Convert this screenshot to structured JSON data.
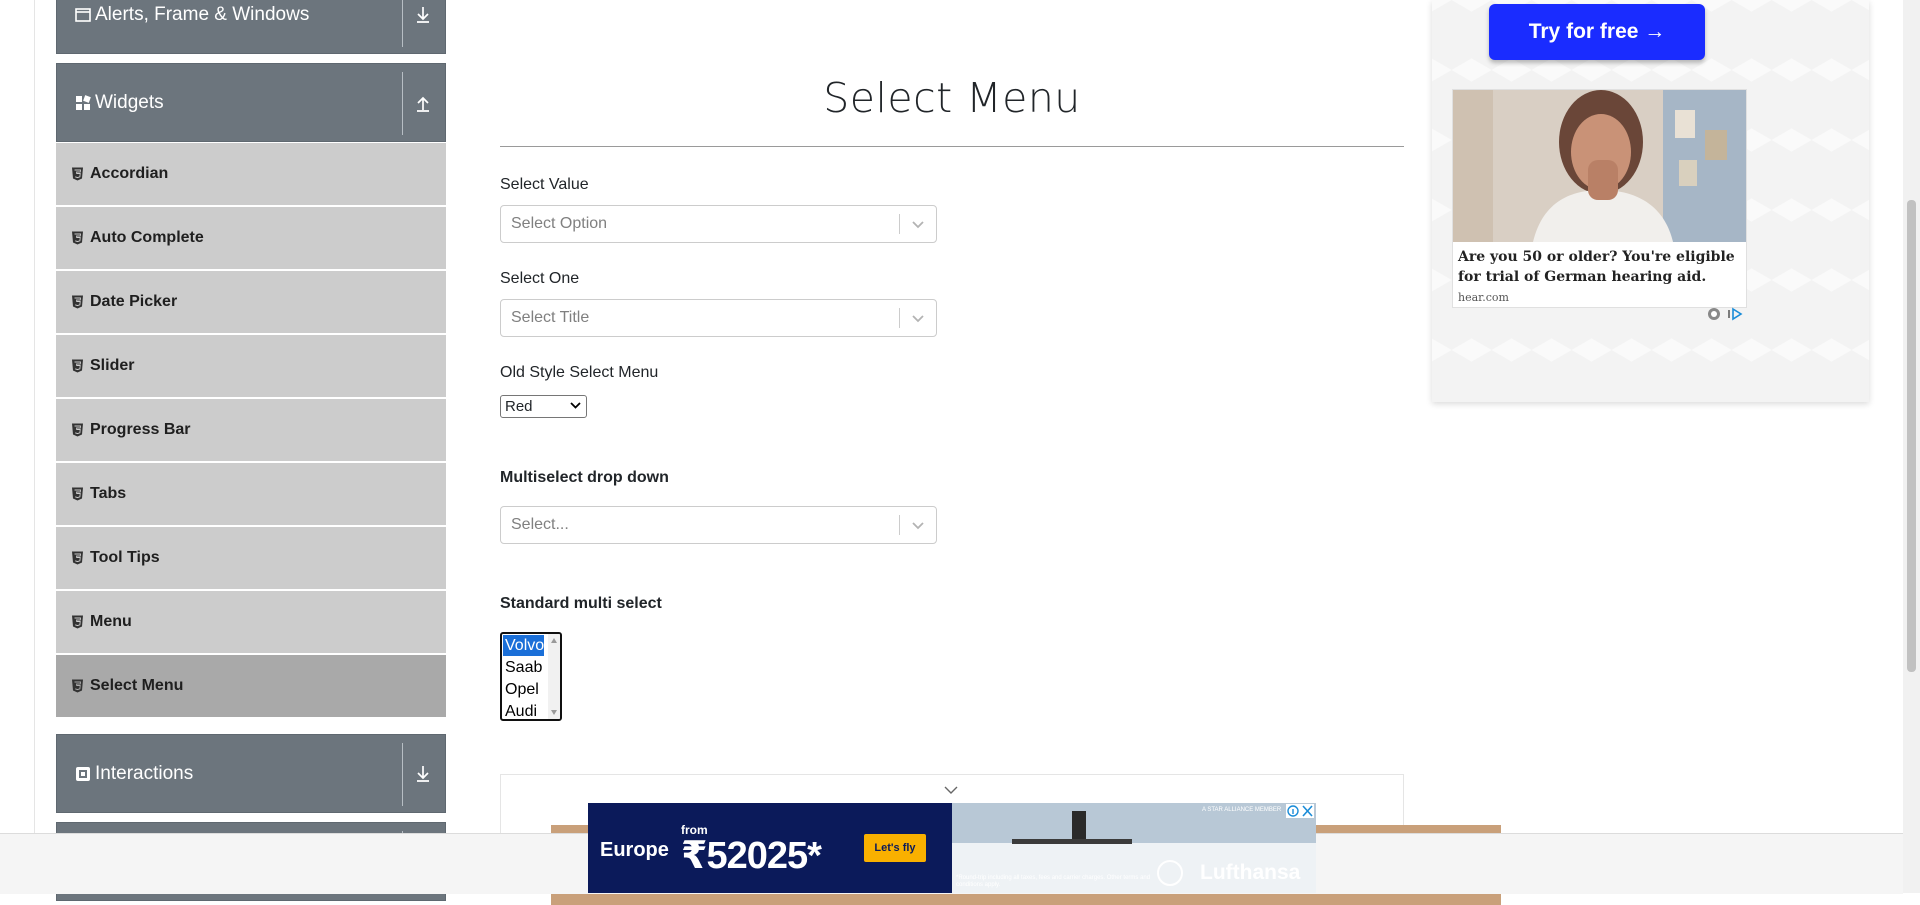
{
  "sidebar": {
    "groups": [
      {
        "label": "Alerts, Frame & Windows",
        "toggle_icon": "arrow-down-icon"
      },
      {
        "label": "Widgets",
        "toggle_icon": "arrow-up-icon"
      },
      {
        "label": "Interactions",
        "toggle_icon": "arrow-down-icon"
      }
    ],
    "items": [
      {
        "label": "Accordian"
      },
      {
        "label": "Auto Complete"
      },
      {
        "label": "Date Picker"
      },
      {
        "label": "Slider"
      },
      {
        "label": "Progress Bar"
      },
      {
        "label": "Tabs"
      },
      {
        "label": "Tool Tips"
      },
      {
        "label": "Menu"
      },
      {
        "label": "Select Menu",
        "active": true
      }
    ]
  },
  "main": {
    "title": "Select Menu",
    "select_value": {
      "label": "Select Value",
      "placeholder": "Select Option"
    },
    "select_one": {
      "label": "Select One",
      "placeholder": "Select Title"
    },
    "old_style": {
      "label": "Old Style Select Menu",
      "value": "Red"
    },
    "multiselect": {
      "label": "Multiselect drop down",
      "placeholder": "Select..."
    },
    "standard_multi": {
      "label": "Standard multi select",
      "options": [
        "Volvo",
        "Saab",
        "Opel",
        "Audi"
      ],
      "selected": "Volvo"
    }
  },
  "right_ad": {
    "button": "Try for free →",
    "text": "Are you 50 or older? You're eligible for trial of German hearing aid.",
    "domain": "hear.com"
  },
  "banner": {
    "destination": "Europe",
    "from": "from",
    "price": "₹52025*",
    "cta": "Let's fly",
    "brand": "Lufthansa",
    "alliance": "A STAR ALLIANCE MEMBER",
    "fine_print": "*Round-trip including all taxes, fees and carrier charges. Other terms and conditions apply."
  },
  "colors": {
    "sidebar_group": "#6c757d",
    "sidebar_item": "#cccccc",
    "sidebar_item_active": "#a9a9a9",
    "ad_button": "#1a2cff",
    "selected_option": "#1a6fd8"
  }
}
